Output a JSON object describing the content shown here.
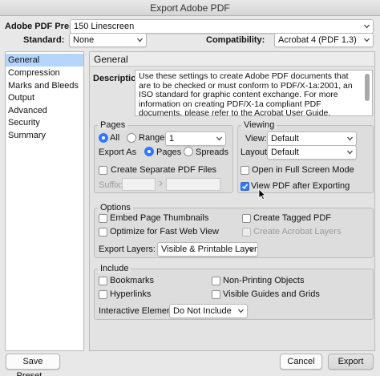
{
  "window": {
    "title": "Export Adobe PDF"
  },
  "top": {
    "preset_label": "Adobe PDF Preset:",
    "preset_value": "150 Linescreen",
    "standard_label": "Standard:",
    "standard_value": "None",
    "compat_label": "Compatibility:",
    "compat_value": "Acrobat 4 (PDF 1.3)"
  },
  "sidebar": {
    "items": [
      {
        "label": "General",
        "selected": true
      },
      {
        "label": "Compression"
      },
      {
        "label": "Marks and Bleeds"
      },
      {
        "label": "Output"
      },
      {
        "label": "Advanced"
      },
      {
        "label": "Security"
      },
      {
        "label": "Summary"
      }
    ]
  },
  "general": {
    "header": "General",
    "description_label": "Description:",
    "description_text": "Use these settings to create Adobe PDF documents that are to be checked or must conform to PDF/X-1a:2001, an ISO standard for graphic content exchange.  For more information on creating PDF/X-1a compliant PDF documents, please refer to the Acrobat User Guide.  Created PDF documents can be opened with Acrobat and"
  },
  "pages": {
    "title": "Pages",
    "all_label": "All",
    "range_label": "Range:",
    "range_value": "1",
    "export_as_label": "Export As",
    "pages_label": "Pages",
    "spreads_label": "Spreads",
    "separate_label": "Create Separate PDF Files",
    "suffix_label": "Suffix:"
  },
  "viewing": {
    "title": "Viewing",
    "view_label": "View:",
    "view_value": "Default",
    "layout_label": "Layout:",
    "layout_value": "Default",
    "fullscreen_label": "Open in Full Screen Mode",
    "view_after_label": "View PDF after Exporting"
  },
  "options": {
    "title": "Options",
    "embed_label": "Embed Page Thumbnails",
    "fastweb_label": "Optimize for Fast Web View",
    "tagged_label": "Create Tagged PDF",
    "acrolayers_label": "Create Acrobat Layers",
    "export_layers_label": "Export Layers:",
    "export_layers_value": "Visible & Printable Layers"
  },
  "include": {
    "title": "Include",
    "bookmarks_label": "Bookmarks",
    "hyperlinks_label": "Hyperlinks",
    "nonprinting_label": "Non-Printing Objects",
    "guides_label": "Visible Guides and Grids",
    "interactive_label": "Interactive Elements:",
    "interactive_value": "Do Not Include"
  },
  "buttons": {
    "save_preset": "Save Preset...",
    "cancel": "Cancel",
    "export": "Export"
  },
  "colors": {
    "accent": "#3478f6",
    "selection": "#b5d5fb"
  }
}
